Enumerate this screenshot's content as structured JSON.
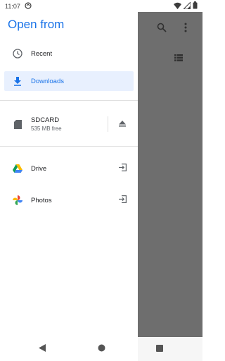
{
  "status_bar": {
    "time": "11:07",
    "icons": [
      "sync-icon",
      "wifi-icon",
      "signal-icon",
      "battery-icon"
    ]
  },
  "drawer": {
    "title": "Open from",
    "recents": {
      "label": "Recent",
      "icon": "clock-icon"
    },
    "downloads": {
      "label": "Downloads",
      "icon": "download-icon",
      "selected": true
    },
    "sdcard": {
      "label": "SDCARD",
      "free": "535 MB free",
      "icon": "sdcard-icon",
      "action_icon": "eject-icon"
    },
    "apps": [
      {
        "label": "Drive",
        "icon": "drive-icon",
        "action_icon": "open-in-icon"
      },
      {
        "label": "Photos",
        "icon": "photos-icon",
        "action_icon": "open-in-icon"
      }
    ]
  },
  "toolbar_icons": [
    "search-icon",
    "more-vert-icon",
    "list-view-icon"
  ],
  "colors": {
    "accent": "#1a73e8",
    "selected_bg": "#e8f0fe",
    "scrim": "#6e6e6e"
  }
}
